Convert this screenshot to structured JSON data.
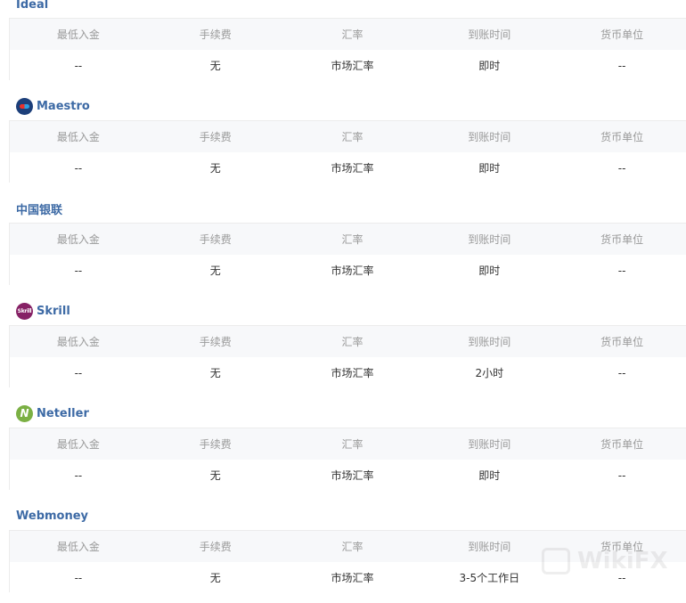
{
  "columns": [
    "最低入金",
    "手续费",
    "汇率",
    "到账时间",
    "货币单位"
  ],
  "methods": [
    {
      "name": "Ideal",
      "logo": "",
      "min_deposit": "--",
      "fee": "无",
      "rate": "市场汇率",
      "arrival": "即时",
      "currency": "--"
    },
    {
      "name": "Maestro",
      "logo": "maestro-logo",
      "min_deposit": "--",
      "fee": "无",
      "rate": "市场汇率",
      "arrival": "即时",
      "currency": "--"
    },
    {
      "name": "中国银联",
      "logo": "",
      "min_deposit": "--",
      "fee": "无",
      "rate": "市场汇率",
      "arrival": "即时",
      "currency": "--"
    },
    {
      "name": "Skrill",
      "logo": "skrill-logo",
      "logo_text": "Skrill",
      "min_deposit": "--",
      "fee": "无",
      "rate": "市场汇率",
      "arrival": "2小时",
      "currency": "--"
    },
    {
      "name": "Neteller",
      "logo": "neteller-logo",
      "logo_text": "N",
      "min_deposit": "--",
      "fee": "无",
      "rate": "市场汇率",
      "arrival": "即时",
      "currency": "--"
    },
    {
      "name": "Webmoney",
      "logo": "",
      "min_deposit": "--",
      "fee": "无",
      "rate": "市场汇率",
      "arrival": "3-5个工作日",
      "currency": "--"
    }
  ],
  "watermark": "WikiFX",
  "colors": {
    "title": "#3d6aa5",
    "header_bg": "#f7f8fa",
    "border": "#ececec"
  }
}
